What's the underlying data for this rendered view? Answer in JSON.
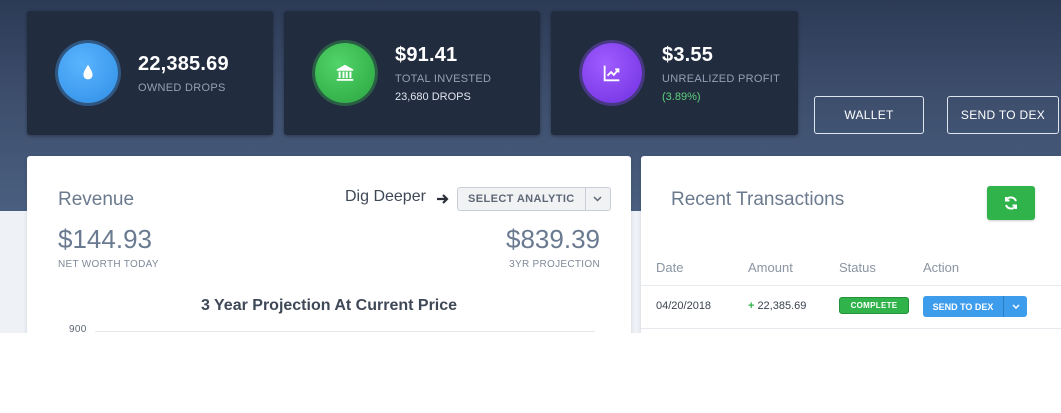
{
  "stats": [
    {
      "value": "22,385.69",
      "label": "OWNED DROPS",
      "sub": "",
      "icon": "water-drop-icon"
    },
    {
      "value": "$91.41",
      "label": "TOTAL INVESTED",
      "sub": "23,680 DROPS",
      "icon": "bank-icon"
    },
    {
      "value": "$3.55",
      "label": "UNREALIZED PROFIT",
      "sub": "(3.89%)",
      "icon": "trending-up-icon"
    }
  ],
  "header_buttons": {
    "wallet": "WALLET",
    "send_to_dex": "SEND TO DEX"
  },
  "revenue": {
    "title": "Revenue",
    "dig_deeper": "Dig Deeper",
    "select_analytic": "SELECT ANALYTIC",
    "net_worth_value": "$144.93",
    "net_worth_label": "NET WORTH TODAY",
    "projection_value": "$839.39",
    "projection_label": "3YR PROJECTION",
    "chart_title": "3 Year Projection At Current Price",
    "chart_ytick": "900"
  },
  "transactions": {
    "title": "Recent Transactions",
    "columns": [
      "Date",
      "Amount",
      "Status",
      "Action"
    ],
    "rows": [
      {
        "date": "04/20/2018",
        "amount": "22,385.69",
        "status": "COMPLETE",
        "action": "SEND TO DEX"
      }
    ]
  },
  "colors": {
    "header_bg": "#2c3a55",
    "card_bg": "#222c3f",
    "success": "#2fb34a",
    "info": "#3d9cec",
    "profit_text": "#5fd17b"
  }
}
